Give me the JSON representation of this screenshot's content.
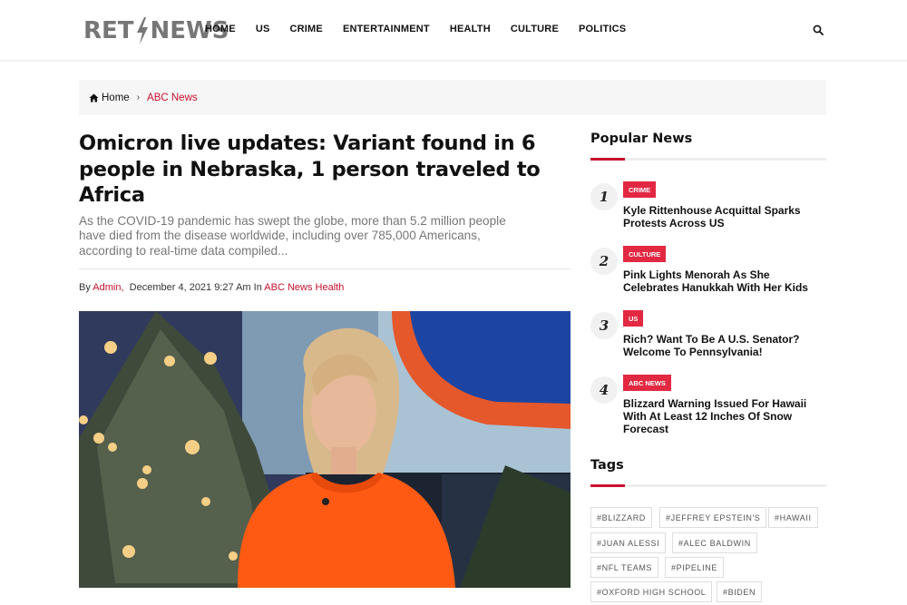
{
  "site": {
    "logo_left": "RET",
    "logo_right": "NEWS"
  },
  "nav": {
    "items": [
      "HOME",
      "US",
      "CRIME",
      "ENTERTAINMENT",
      "HEALTH",
      "CULTURE",
      "POLITICS"
    ]
  },
  "breadcrumb": {
    "home": "Home",
    "separator": "›",
    "current": "ABC News"
  },
  "article": {
    "title_lines": [
      "Omicron live updates: Variant found in 6",
      "people in Nebraska, 1 person traveled to",
      "Africa"
    ],
    "excerpt_lines": [
      "As the COVID-19 pandemic has swept the globe, more than 5.2 million people",
      "have died from the disease worldwide, including over 785,000 Americans,",
      "according to real-time data compiled..."
    ],
    "by_label": "By",
    "author": "Admin,",
    "date": "December 4, 2021 9:27 Am",
    "in_label": "In",
    "category": "ABC News Health"
  },
  "sidebar": {
    "popular_title": "Popular News",
    "popular": [
      {
        "num": "1",
        "badge": "CRIME",
        "title_lines": [
          "Kyle Rittenhouse Acquittal Sparks",
          "Protests Across US"
        ]
      },
      {
        "num": "2",
        "badge": "CULTURE",
        "title_lines": [
          "Pink Lights Menorah As She",
          "Celebrates Hanukkah With Her Kids"
        ]
      },
      {
        "num": "3",
        "badge": "US",
        "title_lines": [
          "Rich? Want To Be A U.S. Senator?",
          "Welcome To Pennsylvania!"
        ]
      },
      {
        "num": "4",
        "badge": "ABC NEWS",
        "title_lines": [
          "Blizzard Warning Issued For Hawaii",
          "With At Least 12 Inches Of Snow",
          "Forecast"
        ]
      }
    ],
    "tags_title": "Tags",
    "tags": [
      "#BLIZZARD",
      "#JEFFREY EPSTEIN'S",
      "#HAWAII",
      "#JUAN ALESSI",
      "#ALEC BALDWIN",
      "#NFL TEAMS",
      "#PIPELINE",
      "#OXFORD HIGH SCHOOL",
      "#BIDEN"
    ]
  },
  "colors": {
    "accent": "#c8102e",
    "badge": "#e32841",
    "logo_gray": "#767676"
  },
  "icons": {
    "search": "search-icon",
    "home": "home-icon",
    "logo_bolt": "lightning-bolt-icon"
  }
}
